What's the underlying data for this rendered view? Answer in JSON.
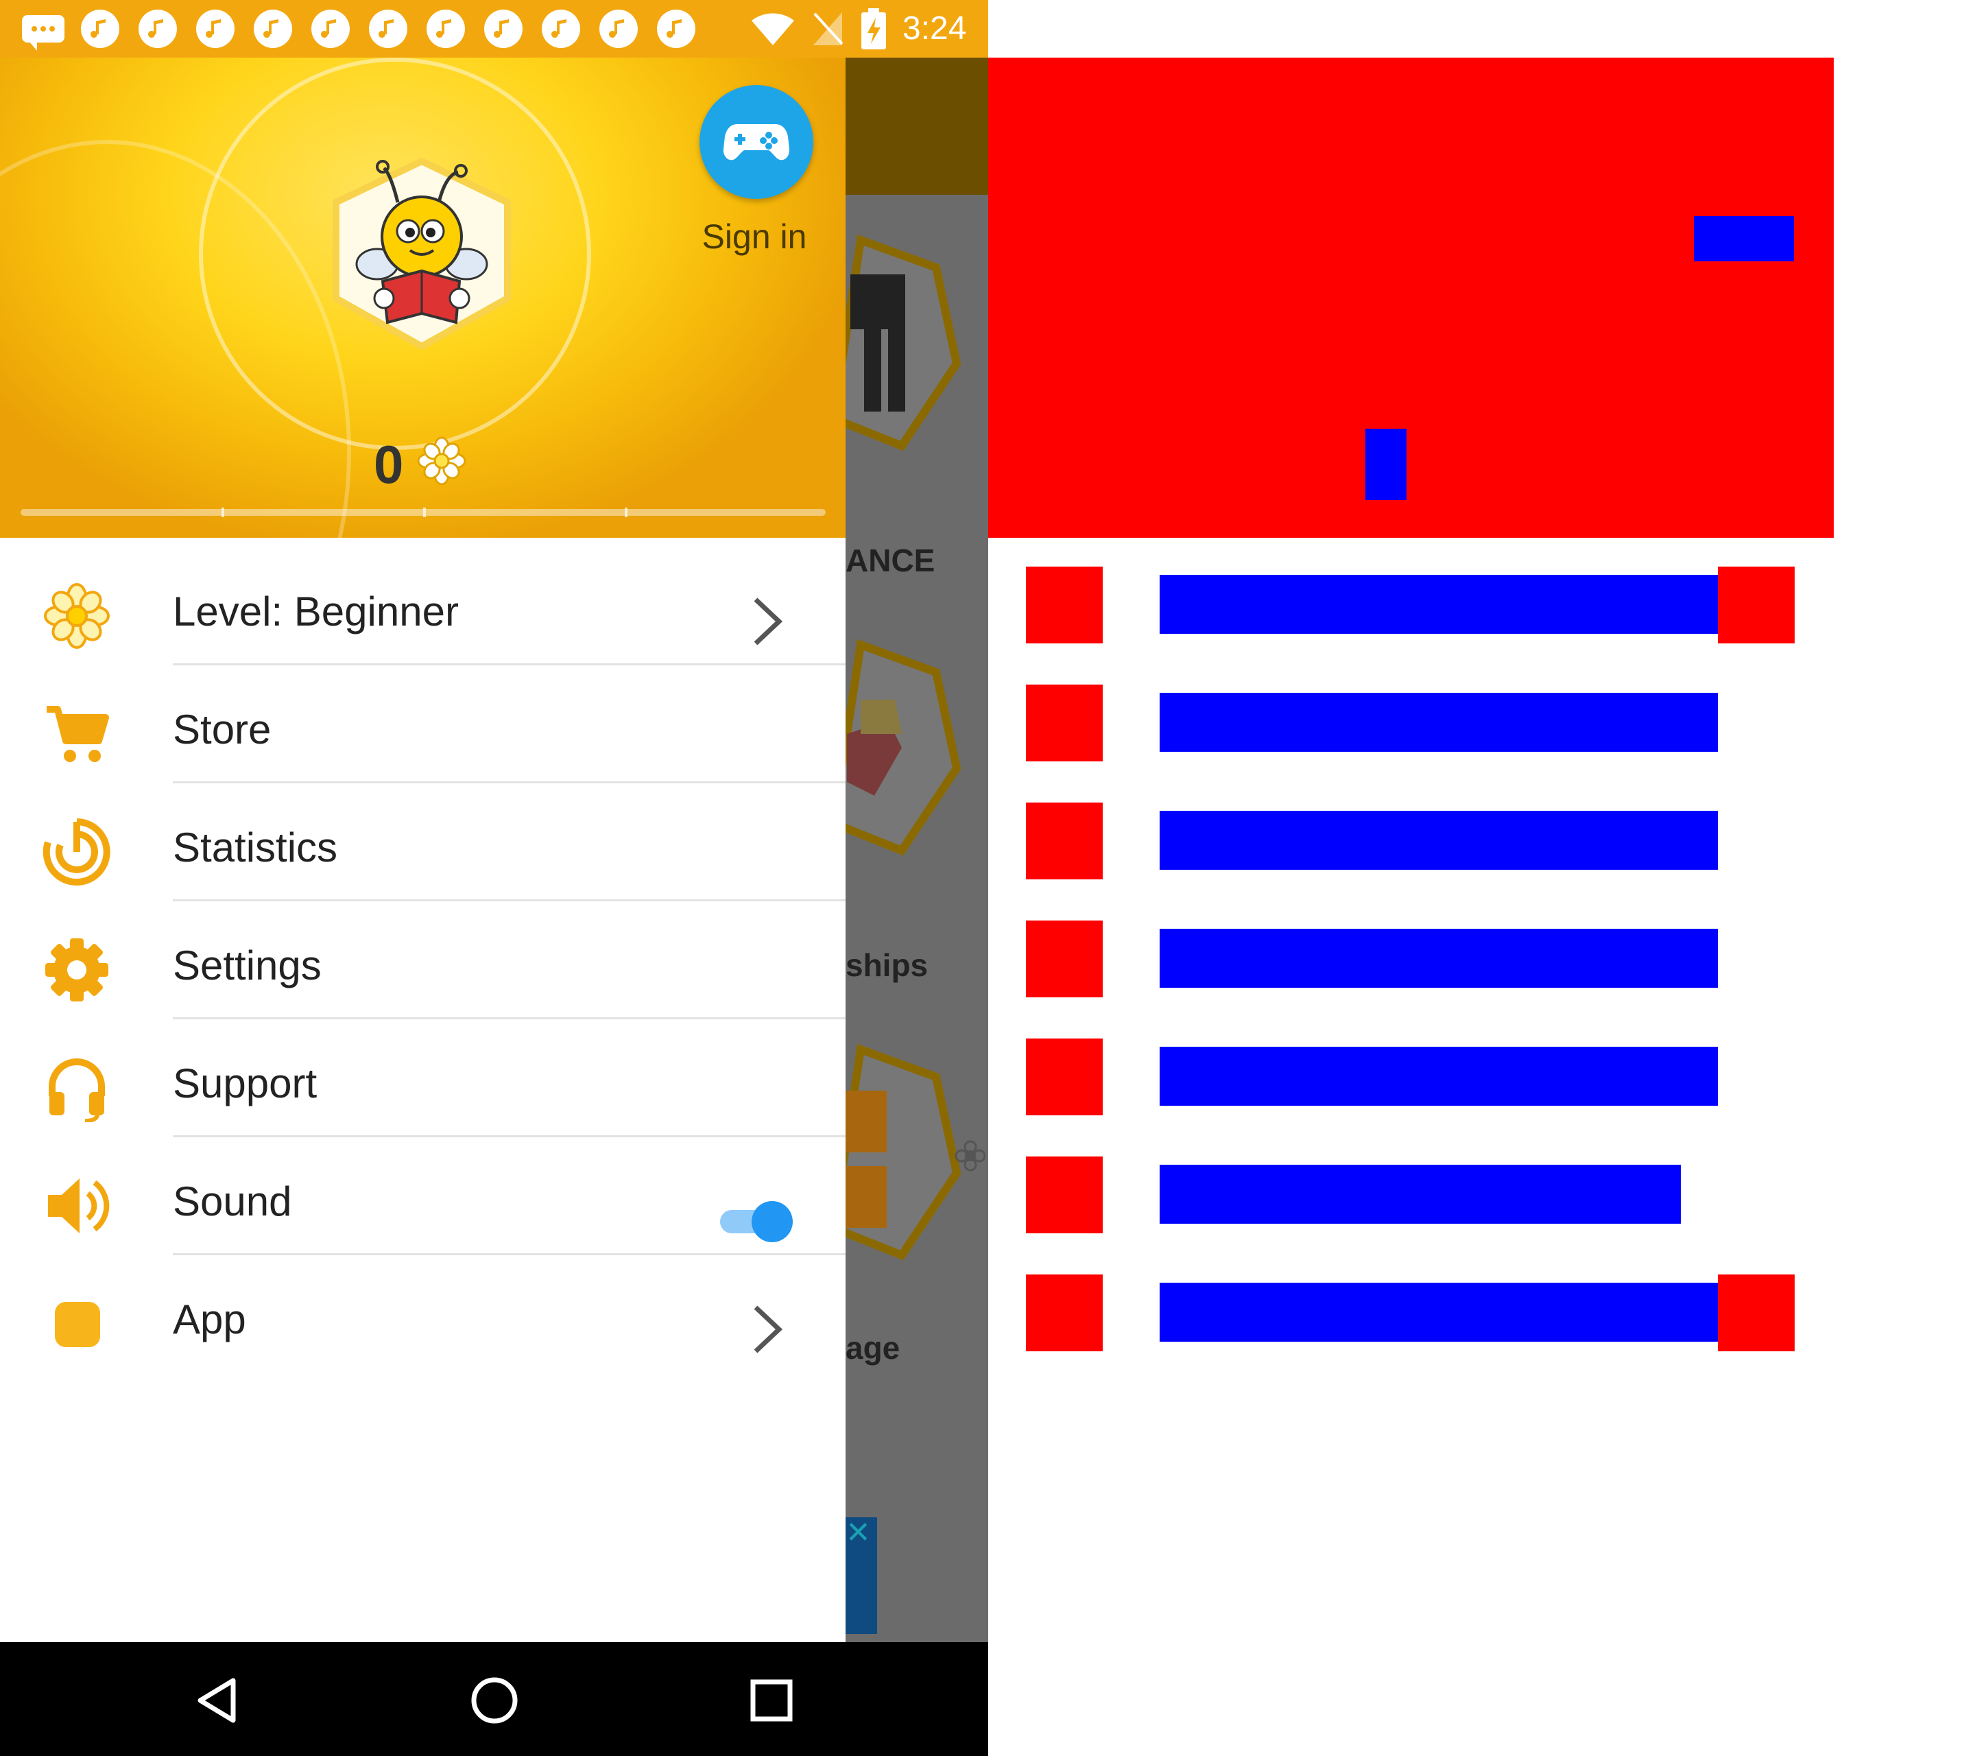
{
  "status_bar": {
    "time": "3:24",
    "notification_icons": [
      "chat-icon",
      "music-note-icon",
      "music-note-icon",
      "music-note-icon",
      "music-note-icon",
      "music-note-icon",
      "music-note-icon",
      "music-note-icon",
      "music-note-icon",
      "music-note-icon",
      "music-note-icon",
      "music-note-icon"
    ],
    "system_icons": [
      "wifi-icon",
      "no-signal-icon",
      "battery-charging-icon"
    ]
  },
  "header": {
    "sign_in_label": "Sign in",
    "points": "0",
    "progress": 0
  },
  "menu": [
    {
      "id": "level",
      "label": "Level: Beginner",
      "icon": "flower-icon",
      "trailing": "chevron"
    },
    {
      "id": "store",
      "label": "Store",
      "icon": "cart-icon",
      "trailing": ""
    },
    {
      "id": "statistics",
      "label": "Statistics",
      "icon": "statistics-icon",
      "trailing": ""
    },
    {
      "id": "settings",
      "label": "Settings",
      "icon": "gear-icon",
      "trailing": ""
    },
    {
      "id": "support",
      "label": "Support",
      "icon": "headset-icon",
      "trailing": ""
    },
    {
      "id": "sound",
      "label": "Sound",
      "icon": "speaker-icon",
      "trailing": "toggle",
      "toggle_on": true
    },
    {
      "id": "app",
      "label": "App",
      "icon": "app-square-icon",
      "trailing": "chevron"
    }
  ],
  "background_app": {
    "labels": [
      "ANCE",
      "ships",
      "age"
    ]
  },
  "colors": {
    "accent": "#f3a70f",
    "sign_in_button": "#1ea5e8",
    "toggle_on": "#2196f3",
    "annotation_red": "#ff0000",
    "annotation_blue": "#0000ff"
  }
}
